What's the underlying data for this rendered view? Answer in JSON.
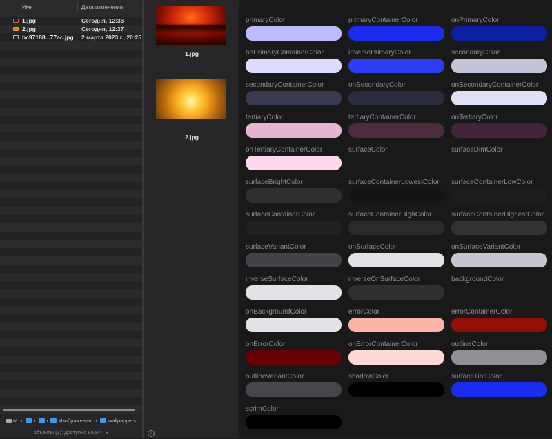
{
  "finder": {
    "columns": {
      "name": "Имя",
      "date": "Дата изменения"
    },
    "files": [
      {
        "name": "1.jpg",
        "date": "Сегодня, 12:36",
        "icon": "image-file-icon"
      },
      {
        "name": "2.jpg",
        "date": "Сегодня, 12:37",
        "icon": "image-file-icon"
      },
      {
        "name": "bc97188...77ac.jpg",
        "date": "2 марта 2023 г., 20:25",
        "icon": "image-file-icon"
      }
    ],
    "path": {
      "drive": "M",
      "images_folder": "Изображения",
      "current_folder": "wallpappers"
    },
    "status": "объекты (3); доступно 85,97 ГБ"
  },
  "gallery": {
    "items": [
      {
        "label": "1.jpg"
      },
      {
        "label": "2.jpg"
      }
    ]
  },
  "colors": [
    {
      "name": "primaryColor",
      "hex": "#bdbcff"
    },
    {
      "name": "primaryContainerColor",
      "hex": "#1a2cf0"
    },
    {
      "name": "onPrimaryColor",
      "hex": "#0d1fa3"
    },
    {
      "name": "onPrimaryContainerColor",
      "hex": "#dcdcff"
    },
    {
      "name": "inversePrimaryColor",
      "hex": "#2b3cf5"
    },
    {
      "name": "secondaryColor",
      "hex": "#c4c4da"
    },
    {
      "name": "secondaryContainerColor",
      "hex": "#383a52"
    },
    {
      "name": "onSecondaryColor",
      "hex": "#2b2c3f"
    },
    {
      "name": "onSecondaryContainerColor",
      "hex": "#e0e0f8"
    },
    {
      "name": "tertiaryColor",
      "hex": "#e7b5d2"
    },
    {
      "name": "tertiaryContainerColor",
      "hex": "#4d2b3e"
    },
    {
      "name": "onTertiaryColor",
      "hex": "#42253a"
    },
    {
      "name": "onTertiaryContainerColor",
      "hex": "#ffd7ee"
    },
    {
      "name": "surfaceColor",
      "hex": ""
    },
    {
      "name": "surfaceDimColor",
      "hex": ""
    },
    {
      "name": "surfaceBrightColor",
      "hex": "#2f2f32"
    },
    {
      "name": "surfaceContainerLowestColor",
      "hex": "#141415"
    },
    {
      "name": "surfaceContainerLowColor",
      "hex": "#1d1d1f"
    },
    {
      "name": "surfaceContainerColor",
      "hex": "#202022"
    },
    {
      "name": "surfaceContainerHighColor",
      "hex": "#2a2a2c"
    },
    {
      "name": "surfaceContainerHighestColor",
      "hex": "#333336"
    },
    {
      "name": "surfaceVariantColor",
      "hex": "#424248"
    },
    {
      "name": "onSurfaceColor",
      "hex": "#e4e2e6"
    },
    {
      "name": "onSurfaceVariantColor",
      "hex": "#c6c5d0"
    },
    {
      "name": "inverseSurfaceColor",
      "hex": "#e4e2e6"
    },
    {
      "name": "inverseOnSurfaceColor",
      "hex": "#303033"
    },
    {
      "name": "backgroundColor",
      "hex": ""
    },
    {
      "name": "onBackgroundColor",
      "hex": "#e4e2e6"
    },
    {
      "name": "errorColor",
      "hex": "#ffb4a9"
    },
    {
      "name": "errorContainerColor",
      "hex": "#930f05"
    },
    {
      "name": "onErrorColor",
      "hex": "#680003"
    },
    {
      "name": "onErrorContainerColor",
      "hex": "#ffdad4"
    },
    {
      "name": "outlineColor",
      "hex": "#909094"
    },
    {
      "name": "outlineVariantColor",
      "hex": "#46464c"
    },
    {
      "name": "shadowColor",
      "hex": "#000000"
    },
    {
      "name": "surfaceTintColor",
      "hex": "#1a2cf0"
    },
    {
      "name": "scrimColor",
      "hex": "#000000"
    }
  ]
}
